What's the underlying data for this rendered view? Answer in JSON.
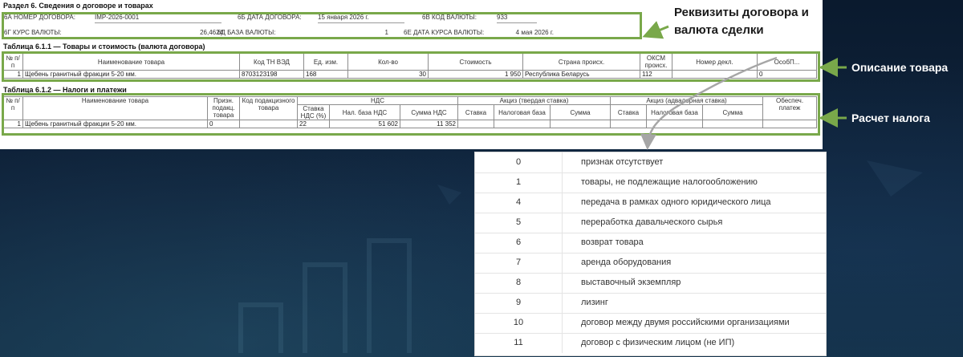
{
  "form": {
    "section_title": "Раздел 6. Сведения о договоре и товарах",
    "contract": {
      "num_label": "6А НОМЕР ДОГОВОРА:",
      "num_value": "IMP-2026-0001",
      "date_label": "6Б ДАТА ДОГОВОРА:",
      "date_value": "15 января 2026 г.",
      "currency_label": "6В КОД ВАЛЮТЫ:",
      "currency_value": "933",
      "rate_label": "6Г КУРС ВАЛЮТЫ:",
      "rate_value": "26,4624",
      "base_label": "6Д БАЗА ВАЛЮТЫ:",
      "base_value": "1",
      "rate_date_label": "6Е ДАТА КУРСА ВАЛЮТЫ:",
      "rate_date_value": "4 мая 2026 г."
    },
    "table1": {
      "title": "Таблица 6.1.1 — Товары и стоимость (валюта договора)",
      "headers": {
        "num": "№ п/п",
        "name": "Наименование товара",
        "code": "Код ТН ВЭД",
        "unit": "Ед. изм.",
        "qty": "Кол-во",
        "cost": "Стоимость",
        "country": "Страна происх.",
        "oksm": "ОКСМ происх.",
        "decl": "Номер декл.",
        "feature": "ОсобП..."
      },
      "row": {
        "num": "1",
        "name": "Щебень гранитный фракции 5-20 мм.",
        "code": "8703123198",
        "unit": "168",
        "qty": "30",
        "cost": "1 950",
        "country": "Республика Беларусь",
        "oksm": "112",
        "decl": "",
        "feature": "0"
      }
    },
    "table2": {
      "title": "Таблица 6.1.2 — Налоги и платежи",
      "headers": {
        "num": "№ п/п",
        "name": "Наименование товара",
        "sign": "Призн. подакц. товара",
        "excise_code": "Код подакцизного товара",
        "vat_group": "НДС",
        "vat_rate": "Ставка НДС (%)",
        "vat_base": "Нал. база НДС",
        "vat_sum": "Сумма НДС",
        "fixed_group": "Акциз (твердая ставка)",
        "fixed_rate": "Ставка",
        "fixed_base": "Налоговая база",
        "fixed_sum": "Сумма",
        "adv_group": "Акциз (адвалорная ставка)",
        "adv_rate": "Ставка",
        "adv_base": "Налоговая база",
        "adv_sum": "Сумма",
        "security": "Обеспеч. платеж"
      },
      "row": {
        "num": "1",
        "name": "Щебень гранитный фракции 5-20 мм.",
        "sign": "0",
        "excise_code": "",
        "vat_rate": "22",
        "vat_base": "51 602",
        "vat_sum": "11 352"
      }
    }
  },
  "callouts": {
    "contract": "Реквизиты договора и валюта сделки",
    "description": "Описание товара",
    "tax": "Расчет налога"
  },
  "codes": [
    {
      "code": "0",
      "text": "признак отсутствует"
    },
    {
      "code": "1",
      "text": "товары, не подлежащие налогообложению"
    },
    {
      "code": "4",
      "text": "передача в рамках одного юридического лица"
    },
    {
      "code": "5",
      "text": "переработка давальческого сырья"
    },
    {
      "code": "6",
      "text": "возврат товара"
    },
    {
      "code": "7",
      "text": "аренда оборудования"
    },
    {
      "code": "8",
      "text": "выставочный экземпляр"
    },
    {
      "code": "9",
      "text": "лизинг"
    },
    {
      "code": "10",
      "text": "договор между двумя российскими организациями"
    },
    {
      "code": "11",
      "text": "договор с физическим лицом (не ИП)"
    }
  ],
  "colors": {
    "accent_green": "#79a84a",
    "arrow_gray": "#a6a6a6",
    "background": "#0d1f35"
  }
}
